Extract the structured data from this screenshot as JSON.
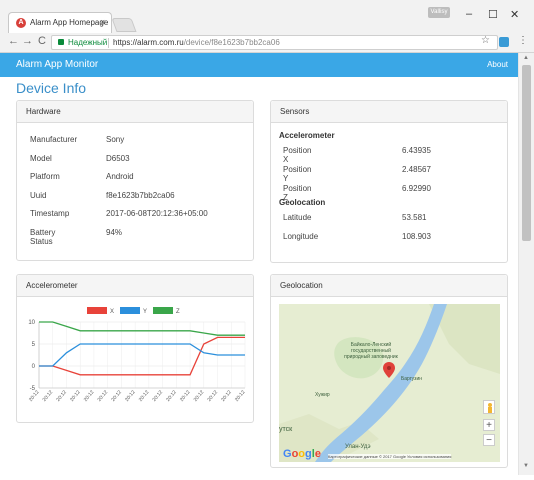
{
  "browser": {
    "tab_title": "Alarm App Homepage",
    "tab_close": "×",
    "favicon": "alarm-icon",
    "user_badge": "Vallisy",
    "window_controls": {
      "minimize": "–",
      "maximize": "☐",
      "close": "✕"
    },
    "nav": {
      "back": "←",
      "forward": "→",
      "reload": "C"
    },
    "secure_label": "Надежный",
    "url_host": "https://alarm.com.ru",
    "url_path": "/device/f8e1623b7bb2ca06",
    "star": "☆",
    "menu": "⋮"
  },
  "app": {
    "brand": "Alarm App Monitor",
    "about": "About",
    "page_title": "Device Info",
    "accent": "#3aa7e6"
  },
  "hardware": {
    "title": "Hardware",
    "rows": [
      {
        "key": "Manufacturer",
        "value": "Sony"
      },
      {
        "key": "Model",
        "value": "D6503"
      },
      {
        "key": "Platform",
        "value": "Android"
      },
      {
        "key": "Uuid",
        "value": "f8e1623b7bb2ca06"
      },
      {
        "key": "Timestamp",
        "value": "2017-06-08T20:12:36+05:00"
      },
      {
        "key": "Battery Status",
        "value": "94%"
      }
    ]
  },
  "sensors": {
    "title": "Sensors",
    "accelerometer_heading": "Accelerometer",
    "accelerometer": [
      {
        "key": "Position X",
        "value": "6.43935"
      },
      {
        "key": "Position Y",
        "value": "2.48567"
      },
      {
        "key": "Position Z",
        "value": "6.92990"
      }
    ],
    "geolocation_heading": "Geolocation",
    "geolocation": [
      {
        "key": "Latitude",
        "value": "53.581"
      },
      {
        "key": "Longitude",
        "value": "108.903"
      }
    ]
  },
  "accelerometer_panel": {
    "title": "Accelerometer"
  },
  "geolocation_panel": {
    "title": "Geolocation",
    "map_labels": {
      "reserve": "Байкало-Ленский государственный природный заповедник",
      "town1": "Баргузин",
      "town2": "Хужир",
      "town3": "утск",
      "town4": "Улан-Удэ"
    },
    "google": "Google",
    "attribution": "Картографические данные © 2017 Google   Условия использования",
    "zoom_in": "+",
    "zoom_out": "−"
  },
  "chart_data": {
    "type": "line",
    "x": [
      "20:12",
      "20:12",
      "20:12",
      "20:12",
      "20:12",
      "20:12",
      "20:12",
      "20:12",
      "20:12",
      "20:12",
      "20:12",
      "20:12",
      "20:12",
      "20:12",
      "20:12",
      "20:12"
    ],
    "series": [
      {
        "name": "X",
        "color": "#e8433a",
        "values": [
          0,
          0,
          -1,
          -2,
          -2,
          -2,
          -2,
          -2,
          -2,
          -2,
          -2,
          -2,
          5,
          6.5,
          6.5,
          6.5
        ]
      },
      {
        "name": "Y",
        "color": "#2b8fdc",
        "values": [
          0,
          0,
          3,
          5,
          5,
          5,
          5,
          5,
          5,
          5,
          5,
          5,
          3,
          2.5,
          2.5,
          2.5
        ]
      },
      {
        "name": "Z",
        "color": "#3aa64a",
        "values": [
          10,
          10,
          9,
          8,
          8,
          8,
          8,
          8,
          8,
          8,
          8,
          8,
          7.5,
          7,
          7,
          7
        ]
      }
    ],
    "y_ticks": [
      10,
      5,
      0,
      -5
    ],
    "ylim": [
      -5,
      10
    ],
    "grid": true,
    "legend": "top"
  }
}
